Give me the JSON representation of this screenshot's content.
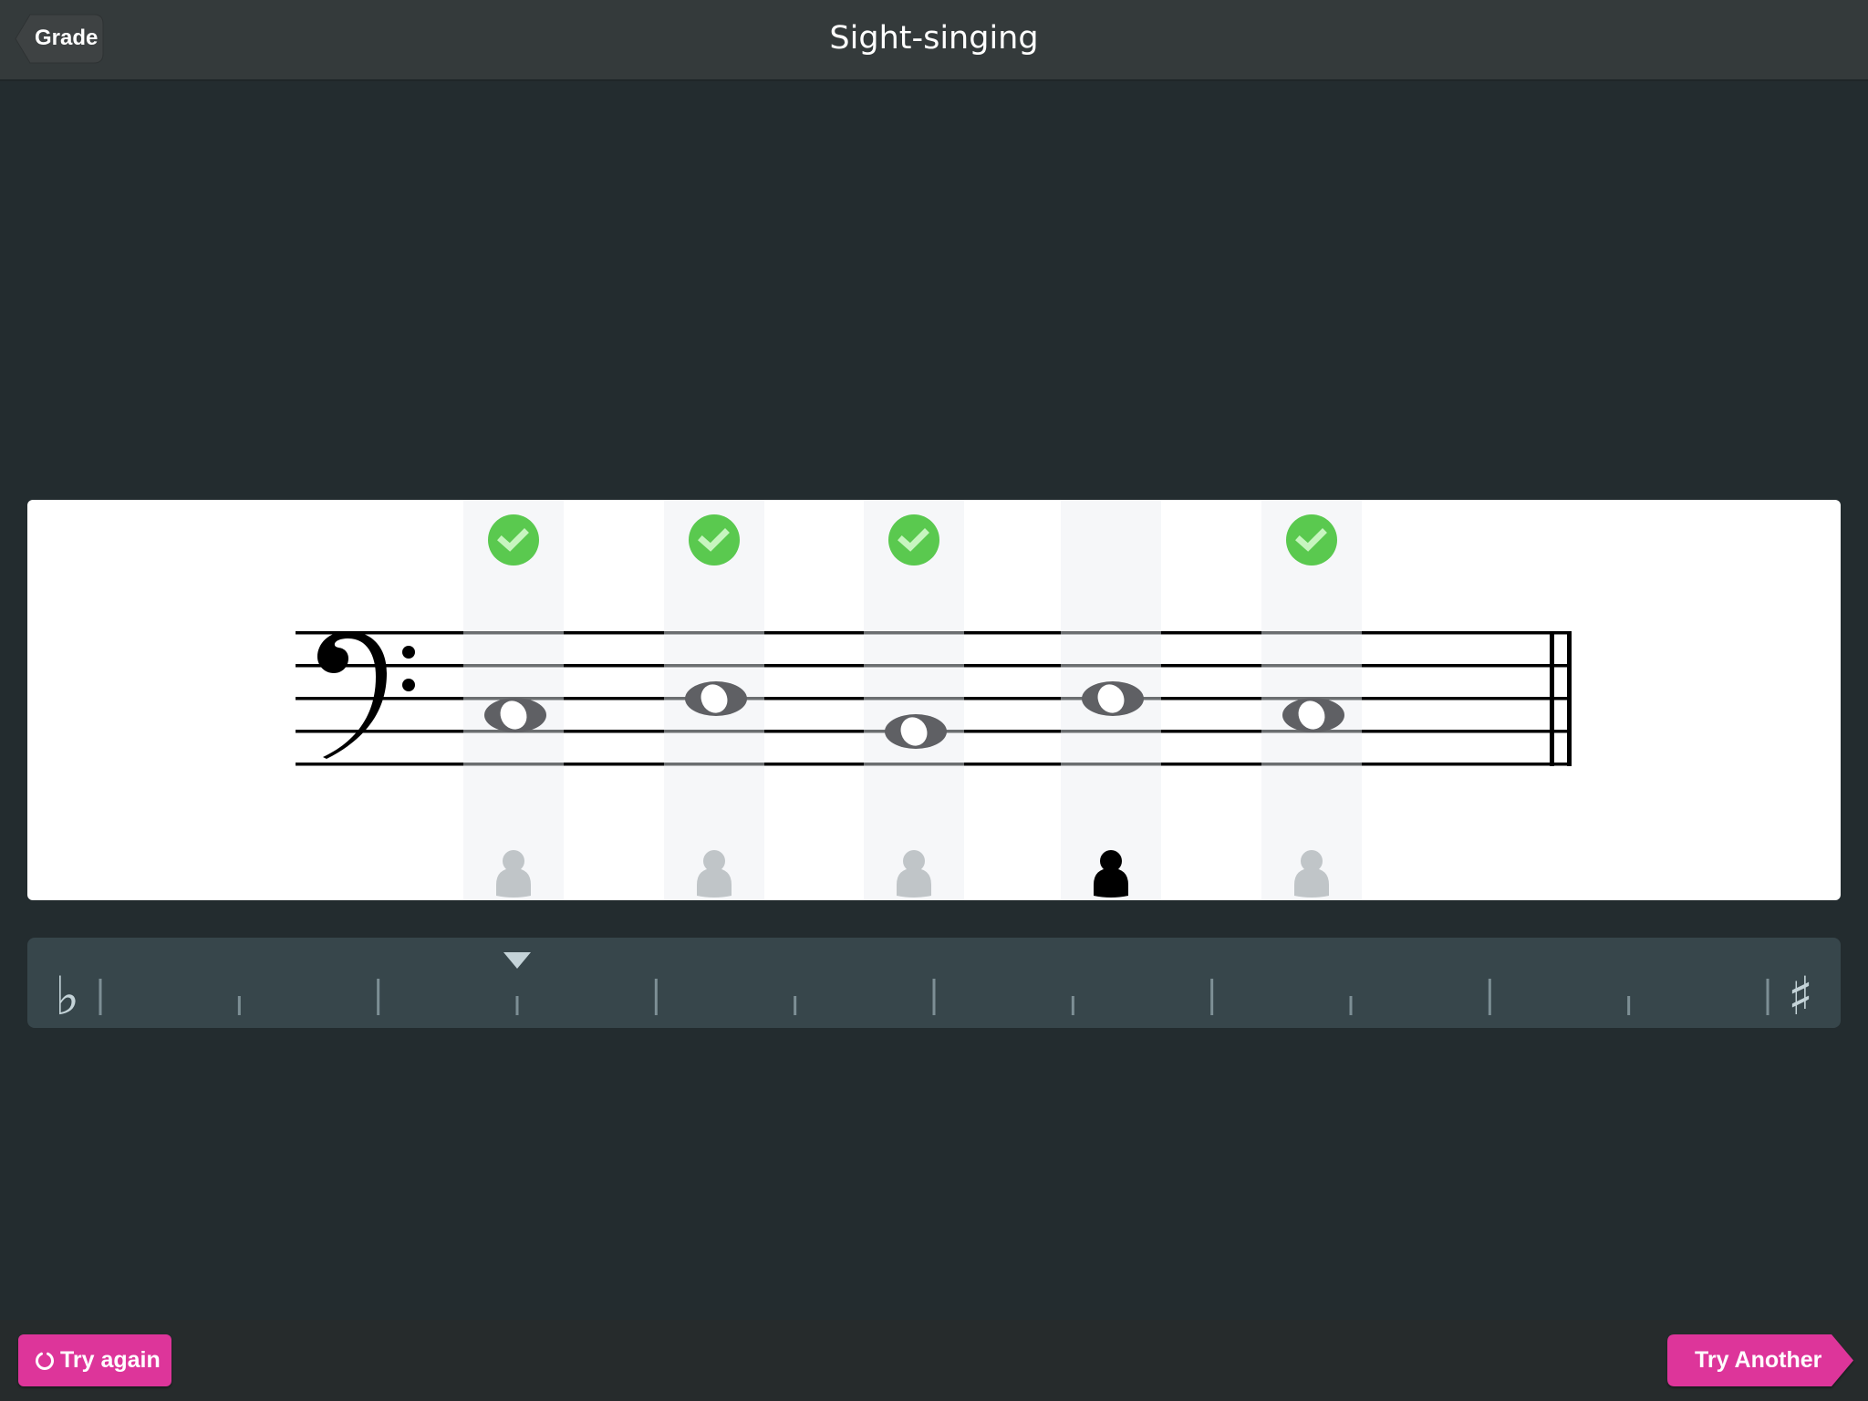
{
  "header": {
    "title": "Sight-singing",
    "back_label": "Grade"
  },
  "exercise": {
    "clef": "bass",
    "notes": [
      {
        "pitch": "C3",
        "result": "correct",
        "current": false
      },
      {
        "pitch": "D3",
        "result": "correct",
        "current": false
      },
      {
        "pitch": "B2",
        "result": "correct",
        "current": false
      },
      {
        "pitch": "D3",
        "result": "none",
        "current": true
      },
      {
        "pitch": "C3",
        "result": "correct",
        "current": false
      }
    ],
    "colors": {
      "check": "#5ac94f",
      "check_mark": "#c7f5bf",
      "note": "#5f6064",
      "column_highlight": "#f6f7f9",
      "singer_inactive": "#c0c5c8",
      "singer_active": "#000000"
    }
  },
  "pitch_meter": {
    "flat_symbol": "♭",
    "sharp_symbol": "♯",
    "tick_count": 13,
    "indicator_tick_index": 3,
    "indicator_fraction": 0.25
  },
  "footer": {
    "try_again_label": "Try again",
    "try_another_label": "Try Another",
    "accent_color": "#dd359a"
  }
}
